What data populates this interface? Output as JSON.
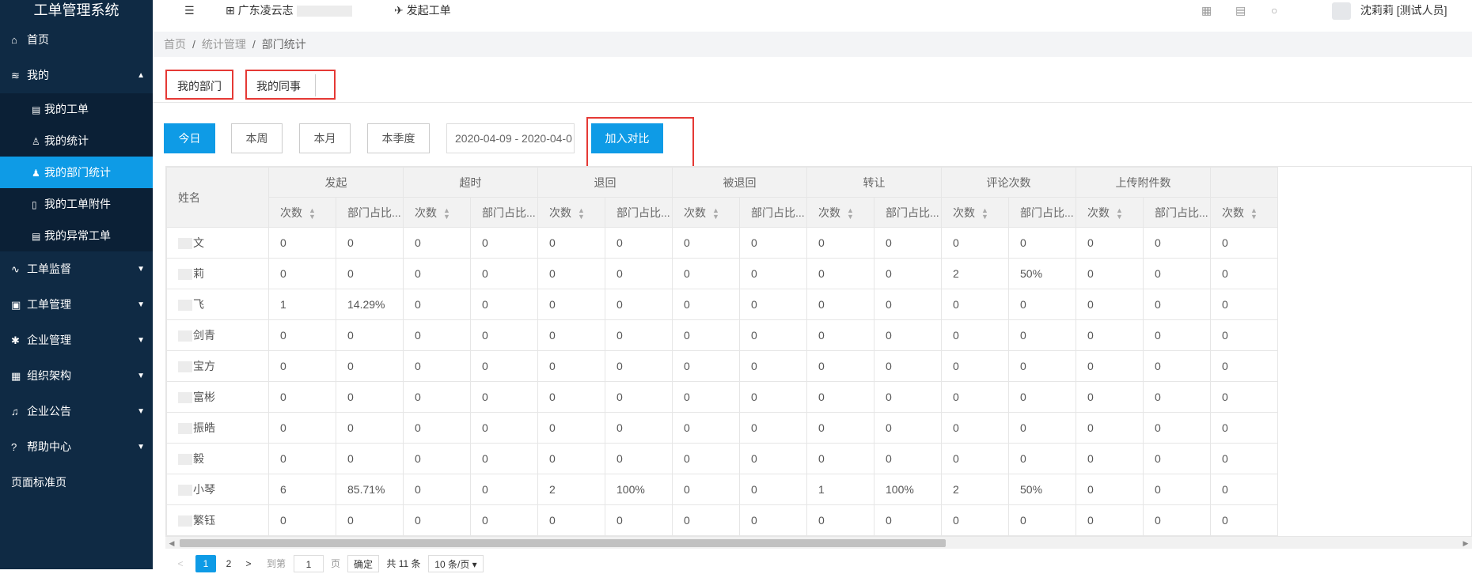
{
  "app": {
    "title": "工单管理系统"
  },
  "sidebar": {
    "items": [
      {
        "label": "首页",
        "icon": "home-icon"
      },
      {
        "label": "我的",
        "icon": "layers-icon",
        "expanded": true,
        "children": [
          {
            "label": "我的工单",
            "icon": "document-icon"
          },
          {
            "label": "我的统计",
            "icon": "user-icon"
          },
          {
            "label": "我的部门统计",
            "icon": "users-icon",
            "active": true
          },
          {
            "label": "我的工单附件",
            "icon": "file-icon"
          },
          {
            "label": "我的异常工单",
            "icon": "document-icon"
          }
        ]
      },
      {
        "label": "工单监督",
        "icon": "pulse-icon"
      },
      {
        "label": "工单管理",
        "icon": "clipboard-icon"
      },
      {
        "label": "企业管理",
        "icon": "gear-icon"
      },
      {
        "label": "组织架构",
        "icon": "org-icon"
      },
      {
        "label": "企业公告",
        "icon": "bell-icon"
      },
      {
        "label": "帮助中心",
        "icon": "question-icon"
      },
      {
        "label": "页面标准页"
      }
    ]
  },
  "topbar": {
    "company": "广东凌云志",
    "new_order": "发起工单",
    "user": "沈莉莉 [测试人员]"
  },
  "breadcrumb": [
    "首页",
    "统计管理",
    "部门统计"
  ],
  "tabs": [
    "我的部门",
    "我的同事"
  ],
  "filters": {
    "buttons": [
      "今日",
      "本周",
      "本月",
      "本季度"
    ],
    "active": "今日",
    "date_range": "2020-04-09 - 2020-04-0",
    "compare_button": "加入对比"
  },
  "table": {
    "name_header": "姓名",
    "groups": [
      "发起",
      "超时",
      "退回",
      "被退回",
      "转让",
      "评论次数",
      "上传附件数",
      ""
    ],
    "sub_headers": [
      "次数",
      "部门占比..."
    ],
    "rows": [
      {
        "name": "文",
        "values": [
          "0",
          "0",
          "0",
          "0",
          "0",
          "0",
          "0",
          "0",
          "0",
          "0",
          "0",
          "0",
          "0",
          "0",
          "0"
        ]
      },
      {
        "name": "莉",
        "values": [
          "0",
          "0",
          "0",
          "0",
          "0",
          "0",
          "0",
          "0",
          "0",
          "0",
          "2",
          "50%",
          "0",
          "0",
          "0"
        ]
      },
      {
        "name": "飞",
        "values": [
          "1",
          "14.29%",
          "0",
          "0",
          "0",
          "0",
          "0",
          "0",
          "0",
          "0",
          "0",
          "0",
          "0",
          "0",
          "0"
        ]
      },
      {
        "name": "剑青",
        "values": [
          "0",
          "0",
          "0",
          "0",
          "0",
          "0",
          "0",
          "0",
          "0",
          "0",
          "0",
          "0",
          "0",
          "0",
          "0"
        ]
      },
      {
        "name": "宝方",
        "values": [
          "0",
          "0",
          "0",
          "0",
          "0",
          "0",
          "0",
          "0",
          "0",
          "0",
          "0",
          "0",
          "0",
          "0",
          "0"
        ]
      },
      {
        "name": "富彬",
        "values": [
          "0",
          "0",
          "0",
          "0",
          "0",
          "0",
          "0",
          "0",
          "0",
          "0",
          "0",
          "0",
          "0",
          "0",
          "0"
        ]
      },
      {
        "name": "振皓",
        "values": [
          "0",
          "0",
          "0",
          "0",
          "0",
          "0",
          "0",
          "0",
          "0",
          "0",
          "0",
          "0",
          "0",
          "0",
          "0"
        ]
      },
      {
        "name": "毅",
        "values": [
          "0",
          "0",
          "0",
          "0",
          "0",
          "0",
          "0",
          "0",
          "0",
          "0",
          "0",
          "0",
          "0",
          "0",
          "0"
        ]
      },
      {
        "name": "小琴",
        "values": [
          "6",
          "85.71%",
          "0",
          "0",
          "2",
          "100%",
          "0",
          "0",
          "1",
          "100%",
          "2",
          "50%",
          "0",
          "0",
          "0"
        ]
      },
      {
        "name": "繁钰",
        "values": [
          "0",
          "0",
          "0",
          "0",
          "0",
          "0",
          "0",
          "0",
          "0",
          "0",
          "0",
          "0",
          "0",
          "0",
          "0"
        ]
      }
    ]
  },
  "pager": {
    "prev": "<",
    "pages": [
      "1",
      "2"
    ],
    "current": "1",
    "next": ">",
    "goto_label": "到第",
    "goto_value": "1",
    "page_unit": "页",
    "confirm": "确定",
    "total": "共 11 条",
    "page_size": "10 条/页"
  }
}
